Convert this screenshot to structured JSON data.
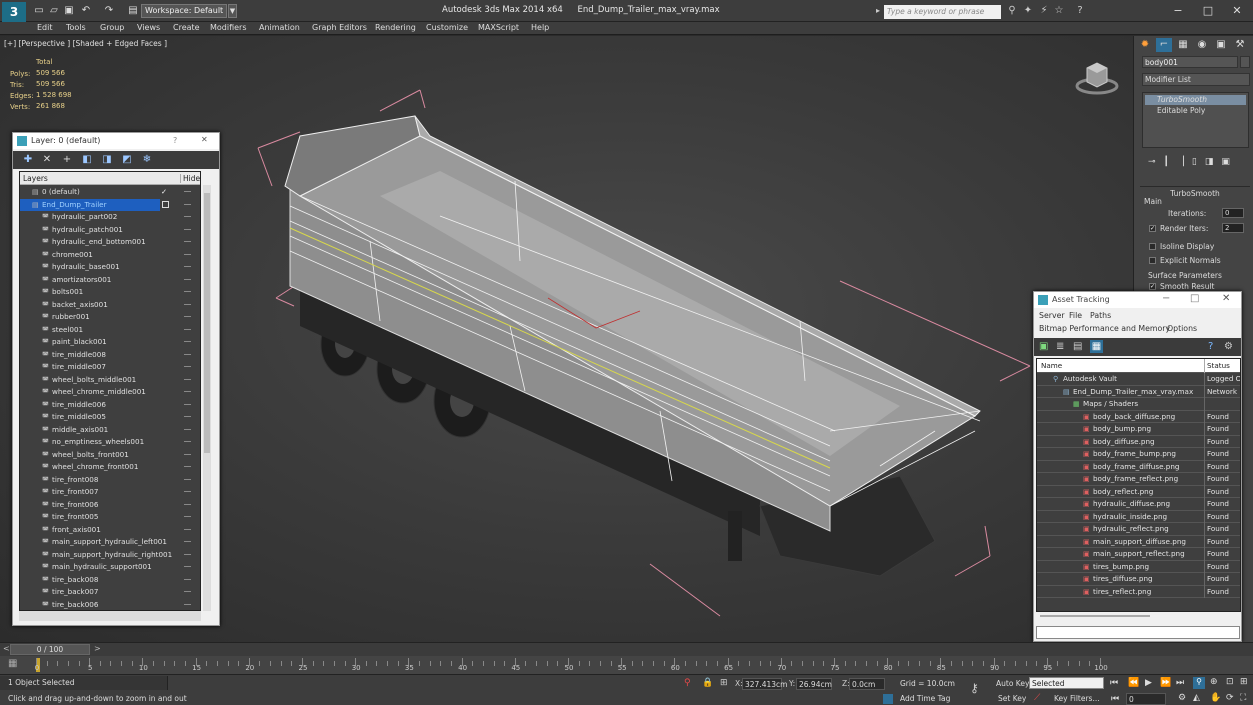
{
  "app": {
    "title": "Autodesk 3ds Max  2014 x64",
    "file": "End_Dump_Trailer_max_vray.max",
    "logo": "3",
    "workspace": "Workspace: Default",
    "search_placeholder": "Type a keyword or phrase"
  },
  "menu": [
    "Edit",
    "Tools",
    "Group",
    "Views",
    "Create",
    "Modifiers",
    "Animation",
    "Graph Editors",
    "Rendering",
    "Customize",
    "MAXScript",
    "Help"
  ],
  "viewport": {
    "label": "[+] [Perspective ] [Shaded + Edged Faces ]",
    "stats": {
      "header": "Total",
      "rows": [
        {
          "label": "Polys:",
          "value": "509 566"
        },
        {
          "label": "Tris:",
          "value": "509 566"
        },
        {
          "label": "Edges:",
          "value": "1 528 698"
        },
        {
          "label": "Verts:",
          "value": "261 868"
        }
      ]
    }
  },
  "command_panel": {
    "object_name": "body001",
    "modifier_list": "Modifier List",
    "stack": [
      "TurboSmooth",
      "Editable Poly"
    ],
    "rollout_title": "TurboSmooth",
    "main_group": "Main",
    "iterations_label": "Iterations:",
    "iterations_value": "0",
    "render_iters_label": "Render Iters:",
    "render_iters_value": "2",
    "isoline_label": "Isoline Display",
    "explicit_label": "Explicit Normals",
    "surface_group": "Surface Parameters",
    "smooth_label": "Smooth Result"
  },
  "layer_window": {
    "title": "Layer: 0 (default)",
    "help": "?",
    "close": "✕",
    "col_layers": "Layers",
    "col_hide": "Hide",
    "rows": [
      {
        "name": "0 (default)",
        "level": 0,
        "check": true
      },
      {
        "name": "End_Dump_Trailer",
        "level": 0,
        "selected": true
      },
      {
        "name": "hydraulic_part002",
        "level": 1
      },
      {
        "name": "hydraulic_patch001",
        "level": 1
      },
      {
        "name": "hydraulic_end_bottom001",
        "level": 1
      },
      {
        "name": "chrome001",
        "level": 1
      },
      {
        "name": "hydraulic_base001",
        "level": 1
      },
      {
        "name": "amortizators001",
        "level": 1
      },
      {
        "name": "bolts001",
        "level": 1
      },
      {
        "name": "backet_axis001",
        "level": 1
      },
      {
        "name": "rubber001",
        "level": 1
      },
      {
        "name": "steel001",
        "level": 1
      },
      {
        "name": "paint_black001",
        "level": 1
      },
      {
        "name": "tire_middle008",
        "level": 1
      },
      {
        "name": "tire_middle007",
        "level": 1
      },
      {
        "name": "wheel_bolts_middle001",
        "level": 1
      },
      {
        "name": "wheel_chrome_middle001",
        "level": 1
      },
      {
        "name": "tire_middle006",
        "level": 1
      },
      {
        "name": "tire_middle005",
        "level": 1
      },
      {
        "name": "middle_axis001",
        "level": 1
      },
      {
        "name": "no_emptiness_wheels001",
        "level": 1
      },
      {
        "name": "wheel_bolts_front001",
        "level": 1
      },
      {
        "name": "wheel_chrome_front001",
        "level": 1
      },
      {
        "name": "tire_front008",
        "level": 1
      },
      {
        "name": "tire_front007",
        "level": 1
      },
      {
        "name": "tire_front006",
        "level": 1
      },
      {
        "name": "tire_front005",
        "level": 1
      },
      {
        "name": "front_axis001",
        "level": 1
      },
      {
        "name": "main_support_hydraulic_left001",
        "level": 1
      },
      {
        "name": "main_support_hydraulic_right001",
        "level": 1
      },
      {
        "name": "main_hydraulic_support001",
        "level": 1
      },
      {
        "name": "tire_back008",
        "level": 1
      },
      {
        "name": "tire_back007",
        "level": 1
      },
      {
        "name": "tire_back006",
        "level": 1
      }
    ]
  },
  "asset_window": {
    "title": "Asset Tracking",
    "menu1": [
      "Server",
      "File",
      "Paths"
    ],
    "menu2": [
      "Bitmap Performance and Memory",
      "Options"
    ],
    "col_name": "Name",
    "col_status": "Status",
    "rows": [
      {
        "name": "Autodesk Vault",
        "status": "Logged O",
        "level": 0
      },
      {
        "name": "End_Dump_Trailer_max_vray.max",
        "status": "Network",
        "level": 1
      },
      {
        "name": "Maps / Shaders",
        "status": "",
        "level": 2
      },
      {
        "name": "body_back_diffuse.png",
        "status": "Found",
        "level": 3
      },
      {
        "name": "body_bump.png",
        "status": "Found",
        "level": 3
      },
      {
        "name": "body_diffuse.png",
        "status": "Found",
        "level": 3
      },
      {
        "name": "body_frame_bump.png",
        "status": "Found",
        "level": 3
      },
      {
        "name": "body_frame_diffuse.png",
        "status": "Found",
        "level": 3
      },
      {
        "name": "body_frame_reflect.png",
        "status": "Found",
        "level": 3
      },
      {
        "name": "body_reflect.png",
        "status": "Found",
        "level": 3
      },
      {
        "name": "hydraulic_diffuse.png",
        "status": "Found",
        "level": 3
      },
      {
        "name": "hydraulic_inside.png",
        "status": "Found",
        "level": 3
      },
      {
        "name": "hydraulic_reflect.png",
        "status": "Found",
        "level": 3
      },
      {
        "name": "main_support_diffuse.png",
        "status": "Found",
        "level": 3
      },
      {
        "name": "main_support_reflect.png",
        "status": "Found",
        "level": 3
      },
      {
        "name": "tires_bump.png",
        "status": "Found",
        "level": 3
      },
      {
        "name": "tires_diffuse.png",
        "status": "Found",
        "level": 3
      },
      {
        "name": "tires_reflect.png",
        "status": "Found",
        "level": 3
      }
    ]
  },
  "timeline": {
    "frame_counter": "0 / 100",
    "ticks": [
      "0",
      "5",
      "10",
      "15",
      "20",
      "25",
      "30",
      "35",
      "40",
      "45",
      "50",
      "55",
      "60",
      "65",
      "70",
      "75",
      "80",
      "85",
      "90",
      "95",
      "100"
    ]
  },
  "status": {
    "selection": "1 Object Selected",
    "prompt": "Click and drag up-and-down to zoom in and out",
    "x_label": "X:",
    "x_value": "327.413cm",
    "y_label": "Y:",
    "y_value": "26.94cm",
    "z_label": "Z:",
    "z_value": "0.0cm",
    "grid": "Grid = 10.0cm",
    "add_time_tag": "Add Time Tag",
    "auto_key": "Auto Key",
    "set_key": "Set Key",
    "selected": "Selected",
    "key_filters": "Key Filters...",
    "frame": "0"
  }
}
